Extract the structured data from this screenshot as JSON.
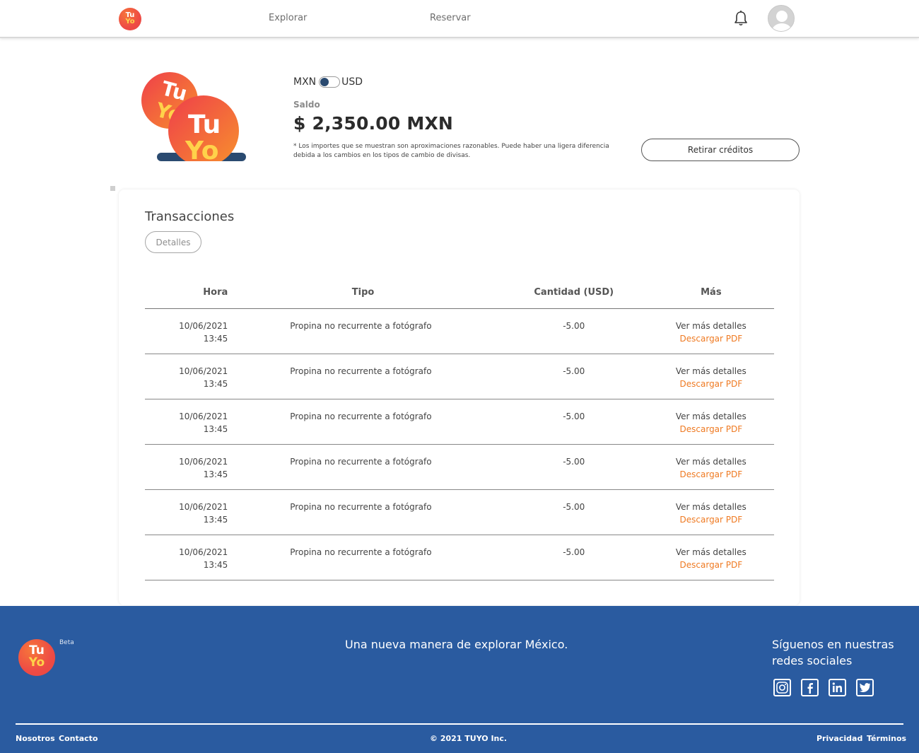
{
  "header": {
    "logo_text": [
      "Tu",
      "Yo"
    ],
    "nav": [
      {
        "label": "Explorar"
      },
      {
        "label": "Reservar"
      }
    ],
    "icons": {
      "notifications": "bell-icon",
      "profile": "avatar-icon"
    }
  },
  "balance": {
    "currency_left": "MXN",
    "currency_right": "USD",
    "toggle_state": "MXN",
    "saldo_label": "Saldo",
    "saldo_value": "$ 2,350.00 MXN",
    "note": "* Los importes que se muestran son aproximaciones razonables. Puede haber una ligera diferencia debida a los cambios en los tipos de cambio de divisas.",
    "withdraw_button": "Retirar créditos"
  },
  "transactions": {
    "title": "Transacciones",
    "details_button": "Detalles",
    "columns": [
      "Hora",
      "Tipo",
      "Cantidad (USD)",
      "Más"
    ],
    "rows": [
      {
        "date": "10/06/2021",
        "time": "13:45",
        "type": "Propina no recurrente a fotógrafo",
        "amount": "-5.00",
        "more": "Ver más detalles",
        "pdf": "Descargar PDF"
      },
      {
        "date": "10/06/2021",
        "time": "13:45",
        "type": "Propina no recurrente a fotógrafo",
        "amount": "-5.00",
        "more": "Ver más detalles",
        "pdf": "Descargar PDF"
      },
      {
        "date": "10/06/2021",
        "time": "13:45",
        "type": "Propina no recurrente a fotógrafo",
        "amount": "-5.00",
        "more": "Ver más detalles",
        "pdf": "Descargar PDF"
      },
      {
        "date": "10/06/2021",
        "time": "13:45",
        "type": "Propina no recurrente a fotógrafo",
        "amount": "-5.00",
        "more": "Ver más detalles",
        "pdf": "Descargar PDF"
      },
      {
        "date": "10/06/2021",
        "time": "13:45",
        "type": "Propina no recurrente a fotógrafo",
        "amount": "-5.00",
        "more": "Ver más detalles",
        "pdf": "Descargar PDF"
      },
      {
        "date": "10/06/2021",
        "time": "13:45",
        "type": "Propina no recurrente a fotógrafo",
        "amount": "-5.00",
        "more": "Ver más detalles",
        "pdf": "Descargar PDF"
      }
    ]
  },
  "footer": {
    "logo_text": [
      "Tu",
      "Yo"
    ],
    "beta": "Beta",
    "tagline": "Una nueva manera de explorar México.",
    "follow": "Síguenos en nuestras redes sociales",
    "socials": [
      "instagram-icon",
      "facebook-icon",
      "linkedin-icon",
      "twitter-icon"
    ],
    "links_left": [
      "Nosotros",
      "Contacto"
    ],
    "copyright": "© 2021 TUYO Inc.",
    "links_right": [
      "Privacidad",
      "Términos"
    ]
  },
  "colors": {
    "brand_orange": "#ef7a22",
    "brand_red": "#ee4b45",
    "brand_yellow": "#ffd24a",
    "footer_blue": "#2a5ba0",
    "toggle_knob": "#2a4a70"
  }
}
